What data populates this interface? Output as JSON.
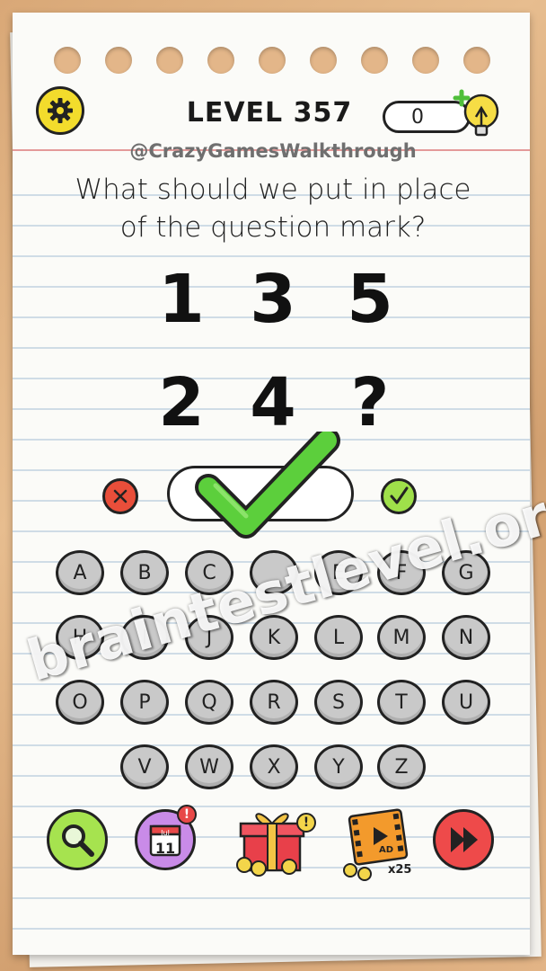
{
  "header": {
    "level_label": "LEVEL 357",
    "hint_count": "0"
  },
  "watermark_top": "@CrazyGamesWalkthrough",
  "watermark_diagonal": "braintestlevel.org",
  "question": {
    "line1": "What should we put in place",
    "line2": "of the question mark?"
  },
  "puzzle": {
    "row1": [
      "1",
      "3",
      "5"
    ],
    "row2": [
      "2",
      "4",
      "?"
    ]
  },
  "answer": {
    "value": ""
  },
  "keyboard": {
    "row1": [
      "A",
      "B",
      "C",
      "E",
      "F",
      "G"
    ],
    "row2": [
      "H",
      "I",
      "J",
      "K",
      "L",
      "M",
      "N"
    ],
    "row3": [
      "O",
      "P",
      "Q",
      "R",
      "S",
      "T",
      "U"
    ],
    "row4": [
      "V",
      "W",
      "X",
      "Y",
      "Z"
    ]
  },
  "bottom": {
    "calendar_month": "Jul",
    "calendar_day": "11",
    "calendar_badge": "!",
    "gift_badge": "!",
    "ad_label": "AD",
    "ad_multiplier": "x25"
  },
  "colors": {
    "settings": "#f3dc2c",
    "wrong": "#e94e3a",
    "right": "#9fe04a",
    "hint": "#a6e34f",
    "calendar": "#c98be8",
    "skip": "#ee4a4a",
    "key": "#c9c9c9"
  },
  "icons": [
    "gear-icon",
    "lightbulb-icon",
    "wrong-x-icon",
    "right-check-icon",
    "big-check-icon",
    "magnifier-icon",
    "calendar-icon",
    "gift-icon",
    "ad-film-icon",
    "skip-icon"
  ]
}
